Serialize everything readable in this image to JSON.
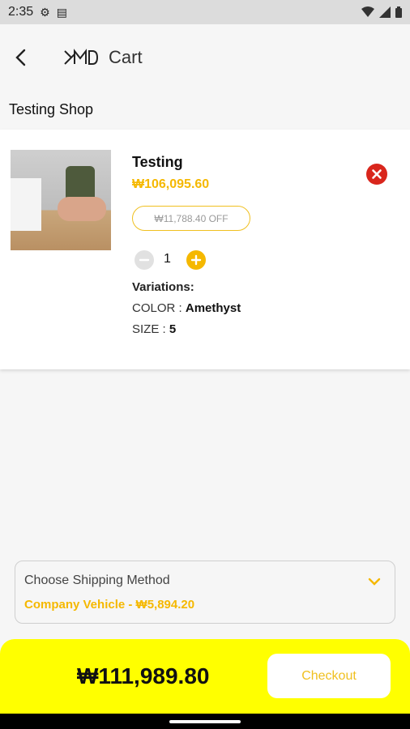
{
  "status_bar": {
    "time": "2:35"
  },
  "app_bar": {
    "logo": "XMD",
    "title": "Cart"
  },
  "shop": {
    "name": "Testing Shop"
  },
  "cart_item": {
    "name": "Testing",
    "price": "₩106,095.60",
    "discount": "₩11,788.40 OFF",
    "quantity": "1",
    "variations_title": "Variations:",
    "color_label": "COLOR : ",
    "color_value": "Amethyst",
    "size_label": "SIZE : ",
    "size_value": "5"
  },
  "shipping": {
    "label": "Choose Shipping Method",
    "selected": "Company Vehicle - ₩5,894.20"
  },
  "footer": {
    "total": "₩111,989.80",
    "checkout_label": "Checkout"
  },
  "colors": {
    "accent": "#f5b800",
    "footer_bg": "#ffff00",
    "remove": "#d9261c"
  }
}
